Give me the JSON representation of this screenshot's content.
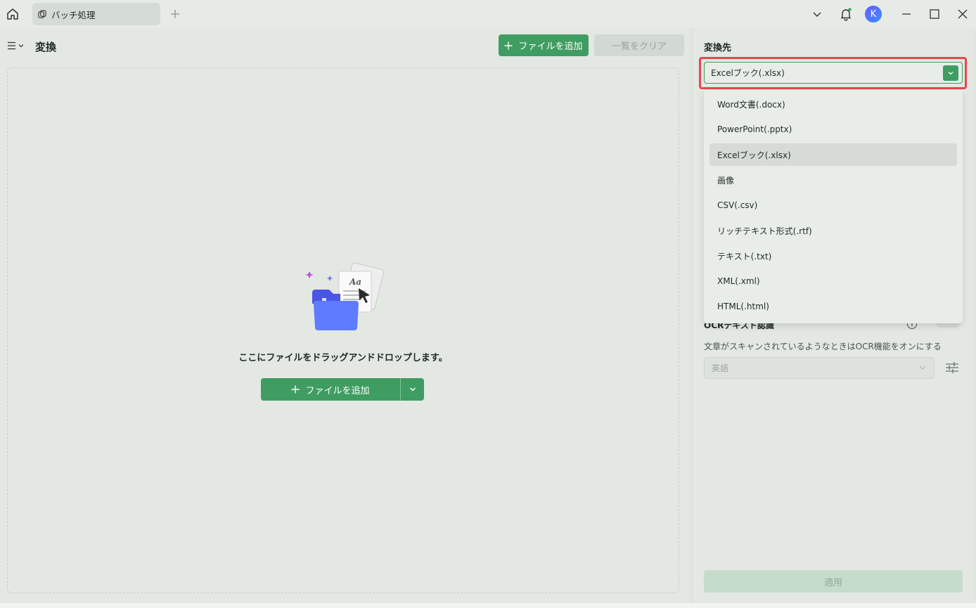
{
  "titlebar": {
    "tab_label": "バッチ処理",
    "avatar_letter": "K"
  },
  "left": {
    "title": "変換",
    "add_button": "ファイルを追加",
    "clear_button": "一覧をクリア",
    "drop_text": "ここにファイルをドラッグアンドドロップします。",
    "drop_add_button": "ファイルを追加",
    "illus_letters": "Aa"
  },
  "right": {
    "title": "変換先",
    "selected_format": "Excelブック(.xlsx)",
    "formats": [
      {
        "label": "Word文書(.docx)",
        "selected": false
      },
      {
        "label": "PowerPoint(.pptx)",
        "selected": false
      },
      {
        "label": "Excelブック(.xlsx)",
        "selected": true
      },
      {
        "label": "画像",
        "selected": false
      },
      {
        "label": "CSV(.csv)",
        "selected": false
      },
      {
        "label": "リッチテキスト形式(.rtf)",
        "selected": false
      },
      {
        "label": "テキスト(.txt)",
        "selected": false
      },
      {
        "label": "XML(.xml)",
        "selected": false
      },
      {
        "label": "HTML(.html)",
        "selected": false
      }
    ],
    "ocr_title": "OCRテキスト認識",
    "ocr_desc": "文章がスキャンされているようなときはOCR機能をオンにする",
    "ocr_language": "英語",
    "apply_button": "適用"
  },
  "colors": {
    "accent": "#3f9d62",
    "highlight": "#e5484d"
  }
}
